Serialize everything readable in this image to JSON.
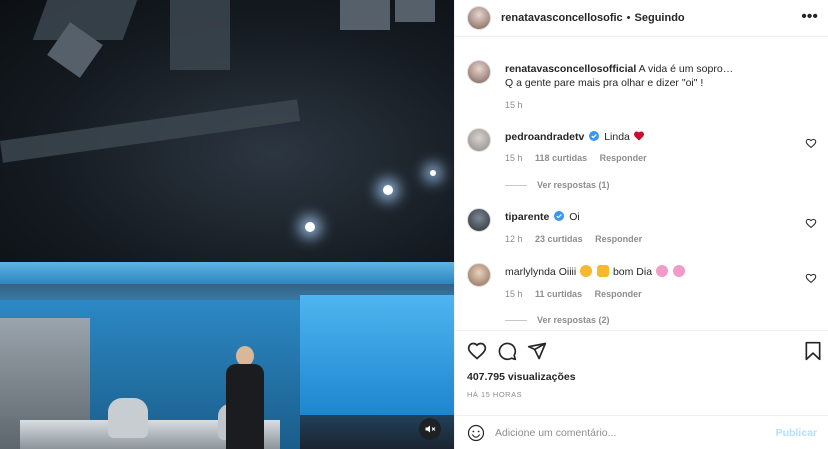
{
  "header": {
    "username": "renatavasconcellosofic",
    "separator": "•",
    "follow_state": "Seguindo",
    "more_label": "•••"
  },
  "caption": {
    "username": "renatavasconcellosofficial",
    "text_line1": "A vida é um sopro…",
    "text_line2": "Q a gente pare mais pra olhar e dizer \"oi\" !",
    "time": "15 h"
  },
  "comments": [
    {
      "username": "pedroandradetv",
      "verified": true,
      "text": "Linda",
      "emoji": "red-heart",
      "time": "15 h",
      "likes": "118 curtidas",
      "reply": "Responder",
      "view_replies": "Ver respostas (1)"
    },
    {
      "username": "tiparente",
      "verified": true,
      "text": "Oi",
      "time": "12 h",
      "likes": "23 curtidas",
      "reply": "Responder"
    },
    {
      "username": "marlylynda",
      "verified": false,
      "text_a": "Oiiii",
      "text_b": "bom Dia",
      "time": "15 h",
      "likes": "11 curtidas",
      "reply": "Responder",
      "view_replies": "Ver respostas (2)"
    }
  ],
  "stats": {
    "views": "407.795 visualizações",
    "time_ago": "HÁ 15 HORAS"
  },
  "composer": {
    "placeholder": "Adicione um comentário...",
    "post_label": "Publicar"
  },
  "icons": {
    "like": "heart-outline-icon",
    "comment": "comment-bubble-icon",
    "share": "paper-plane-icon",
    "save": "bookmark-icon",
    "mute": "speaker-muted-icon",
    "emoji": "smiley-icon"
  },
  "colors": {
    "verified": "#3897f0",
    "post_disabled": "#b2dffc",
    "secondary_text": "#8e8e8e",
    "heart_red": "#ed4956"
  }
}
